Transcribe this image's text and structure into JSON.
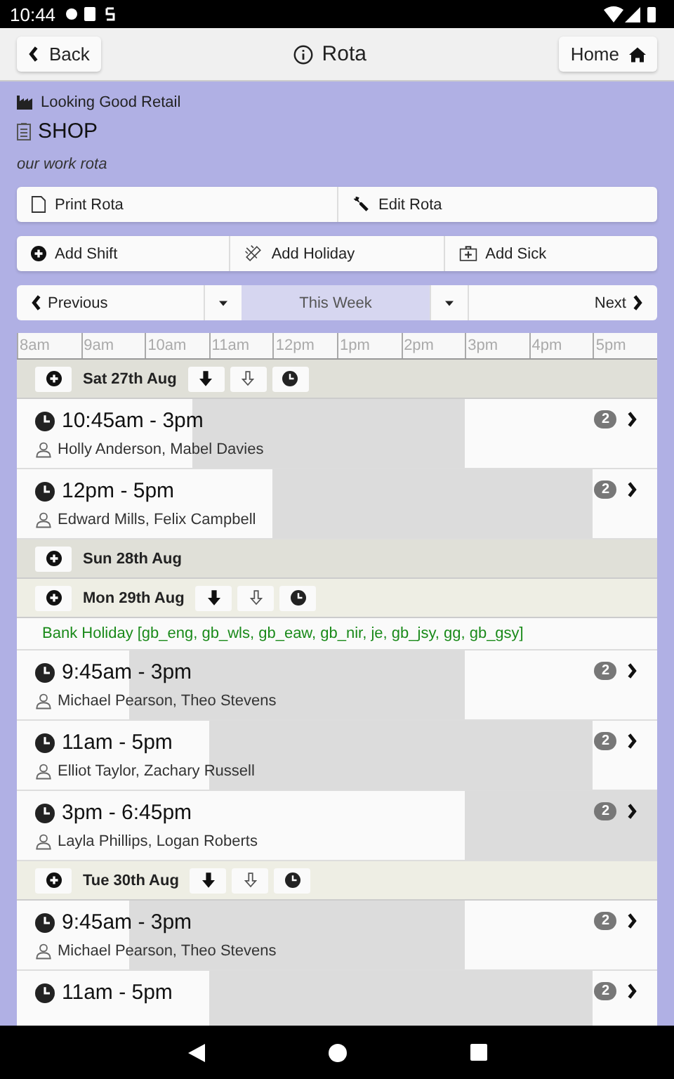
{
  "status_bar": {
    "time": "10:44"
  },
  "header": {
    "back": "Back",
    "title": "Rota",
    "home": "Home"
  },
  "company": "Looking Good Retail",
  "rota_name": "SHOP",
  "description": "our work rota",
  "toolbar_1": [
    {
      "label": "Print Rota",
      "kind": "print"
    },
    {
      "label": "Edit Rota",
      "kind": "edit"
    }
  ],
  "toolbar_2": [
    {
      "label": "Add Shift",
      "kind": "add"
    },
    {
      "label": "Add Holiday",
      "kind": "holiday"
    },
    {
      "label": "Add Sick",
      "kind": "sick"
    }
  ],
  "week_nav": {
    "previous": "Previous",
    "current": "This Week",
    "next": "Next"
  },
  "timeline": [
    "8am",
    "9am",
    "10am",
    "11am",
    "12pm",
    "1pm",
    "2pm",
    "3pm",
    "4pm",
    "5pm"
  ],
  "days": [
    {
      "label": "Sat 27th Aug",
      "weekend": true,
      "actions": true,
      "items": [
        {
          "kind": "shift",
          "time": "10:45am - 3pm",
          "people": "Holly Anderson, Mabel Davies",
          "count": "2"
        },
        {
          "kind": "shift",
          "time": "12pm - 5pm",
          "people": "Edward Mills, Felix Campbell",
          "count": "2"
        }
      ]
    },
    {
      "label": "Sun 28th Aug",
      "weekend": true,
      "actions": false
    },
    {
      "label": "Mon 29th Aug",
      "weekend": false,
      "actions": true,
      "items": [
        {
          "kind": "holiday",
          "text": "Bank Holiday [gb_eng, gb_wls, gb_eaw, gb_nir, je, gb_jsy, gg, gb_gsy]"
        },
        {
          "kind": "shift",
          "time": "9:45am - 3pm",
          "people": "Michael Pearson, Theo Stevens",
          "count": "2"
        },
        {
          "kind": "shift",
          "time": "11am - 5pm",
          "people": "Elliot Taylor, Zachary Russell",
          "count": "2"
        },
        {
          "kind": "shift",
          "time": "3pm - 6:45pm",
          "people": "Layla Phillips, Logan Roberts",
          "count": "2"
        }
      ]
    },
    {
      "label": "Tue 30th Aug",
      "weekend": false,
      "actions": true,
      "items": [
        {
          "kind": "shift",
          "time": "9:45am - 3pm",
          "people": "Michael Pearson, Theo Stevens",
          "count": "2"
        },
        {
          "kind": "shift",
          "time": "11am - 5pm",
          "count": "2"
        }
      ]
    }
  ]
}
